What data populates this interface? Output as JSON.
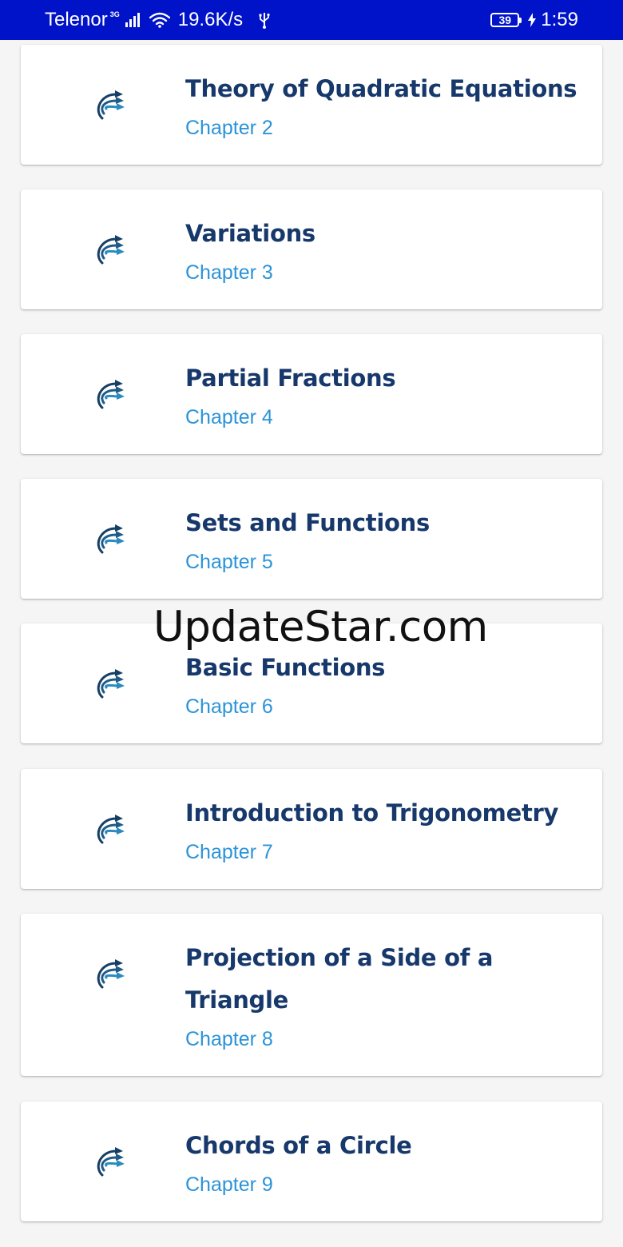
{
  "status_bar": {
    "carrier": "Telenor",
    "network_type": "3G",
    "speed": "19.6K/s",
    "battery": "39",
    "time": "1:59",
    "icons": [
      "signal-icon",
      "wifi-icon",
      "usb-icon",
      "battery-icon",
      "charging-icon"
    ]
  },
  "colors": {
    "status_bar_bg": "#0013c8",
    "title": "#17386b",
    "chapter": "#2b93d8",
    "background": "#f5f5f5"
  },
  "chapters": [
    {
      "title": "Theory of Quadratic Equations",
      "chapter": "Chapter 2",
      "icon": "arrows-logo-icon"
    },
    {
      "title": "Variations",
      "chapter": "Chapter 3",
      "icon": "arrows-logo-icon"
    },
    {
      "title": "Partial Fractions",
      "chapter": "Chapter 4",
      "icon": "arrows-logo-icon"
    },
    {
      "title": "Sets and Functions",
      "chapter": "Chapter 5",
      "icon": "arrows-logo-icon"
    },
    {
      "title": "Basic Functions",
      "chapter": "Chapter 6",
      "icon": "arrows-logo-icon"
    },
    {
      "title": "Introduction to Trigonometry",
      "chapter": "Chapter 7",
      "icon": "arrows-logo-icon"
    },
    {
      "title": "Projection of a Side of a Triangle",
      "chapter": "Chapter 8",
      "icon": "arrows-logo-icon"
    },
    {
      "title": "Chords of a Circle",
      "chapter": "Chapter 9",
      "icon": "arrows-logo-icon"
    }
  ],
  "watermark": "UpdateStar.com"
}
